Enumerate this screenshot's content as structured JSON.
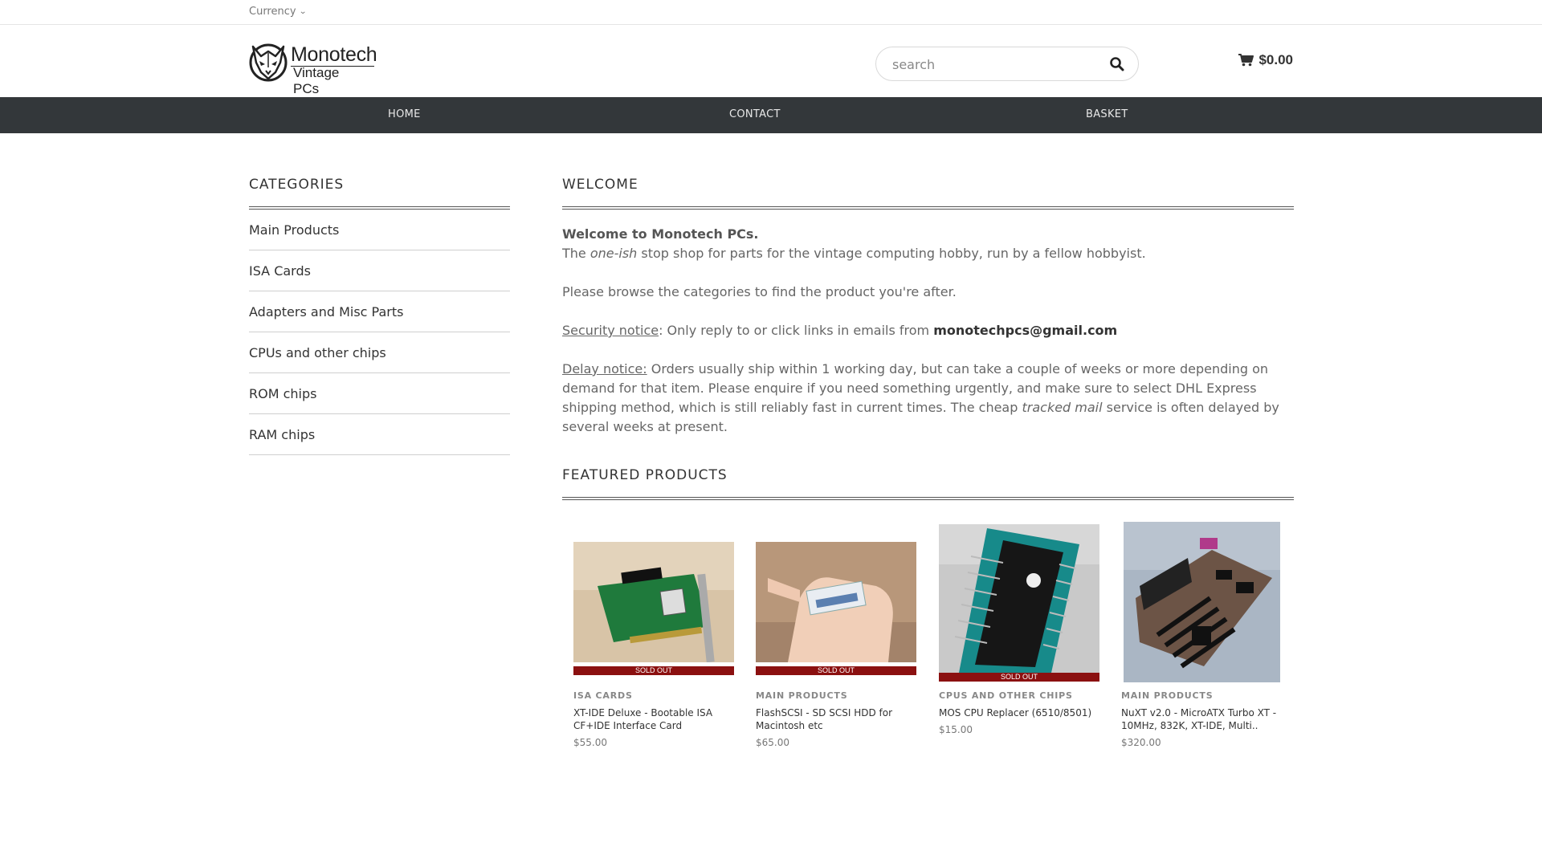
{
  "topbar": {
    "currency_label": "Currency"
  },
  "header": {
    "logo_line1": "Monotech",
    "logo_line2": "Vintage PCs",
    "search_placeholder": "search",
    "cart_total": "$0.00"
  },
  "nav": {
    "items": [
      "HOME",
      "CONTACT",
      "BASKET"
    ]
  },
  "sidebar": {
    "title": "CATEGORIES",
    "categories": [
      "Main Products",
      "ISA Cards",
      "Adapters and Misc Parts",
      "CPUs and other chips",
      "ROM chips",
      "RAM chips"
    ]
  },
  "welcome": {
    "title": "WELCOME",
    "heading": "Welcome to Monotech PCs.",
    "line1_pre": "The ",
    "line1_em": "one-ish",
    "line1_post": " stop shop for parts for the vintage computing hobby, run by a fellow hobbyist.",
    "browse": "Please browse the categories to find the product you're after.",
    "security_label": "Security notice",
    "security_text": ": Only reply to or click links in emails from ",
    "security_email": "monotechpcs@gmail.com",
    "delay_label": "Delay notice:",
    "delay_text1": " Orders usually ship within 1 working day, but can take a couple of weeks or more depending on demand for that item. Please enquire if you need something urgently, and make sure to select DHL Express shipping method, which is still reliably fast in current times. The cheap ",
    "delay_em": "tracked mail",
    "delay_text2": " service is often delayed by several weeks at present."
  },
  "featured": {
    "title": "FEATURED PRODUCTS",
    "products": [
      {
        "category": "ISA CARDS",
        "name": "XT-IDE Deluxe - Bootable ISA CF+IDE Interface Card",
        "price": "$55.00",
        "badge": "SOLD OUT"
      },
      {
        "category": "MAIN PRODUCTS",
        "name": "FlashSCSI - SD SCSI HDD for Macintosh etc",
        "price": "$65.00",
        "badge": "SOLD OUT"
      },
      {
        "category": "CPUS AND OTHER CHIPS",
        "name": "MOS CPU Replacer (6510/8501)",
        "price": "$15.00",
        "badge": "SOLD OUT"
      },
      {
        "category": "MAIN PRODUCTS",
        "name": "NuXT v2.0 - MicroATX Turbo XT - 10MHz, 832K, XT-IDE, Multi..",
        "price": "$320.00",
        "badge": ""
      }
    ]
  },
  "colors": {
    "nav_bg": "#33373a",
    "sold_out": "#8b1010"
  }
}
